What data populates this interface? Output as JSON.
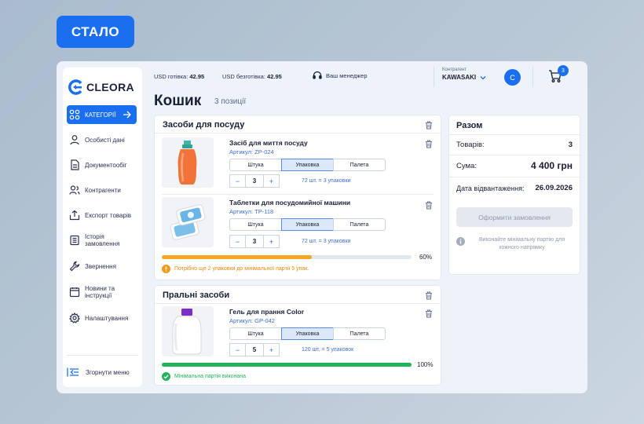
{
  "badge": "СТАЛО",
  "brand": {
    "name": "CLEORA",
    "accent": "#1a6ff0"
  },
  "sidebar": {
    "items": [
      {
        "label": "КАТЕГОРІЇ",
        "icon": "grid-icon",
        "active": true
      },
      {
        "label": "Особисті дані",
        "icon": "user-icon"
      },
      {
        "label": "Документообіг",
        "icon": "document-icon"
      },
      {
        "label": "Контрагенти",
        "icon": "users-icon"
      },
      {
        "label": "Експорт товарів",
        "icon": "upload-icon"
      },
      {
        "label": "Історія замовлення",
        "icon": "list-icon"
      },
      {
        "label": "Звернення",
        "icon": "wrench-icon"
      },
      {
        "label": "Новини та інструкції",
        "icon": "calendar-icon"
      },
      {
        "label": "Налаштування",
        "icon": "gear-icon"
      }
    ],
    "collapse_label": "Згорнути меню"
  },
  "topbar": {
    "usd_cash_label": "USD готівка:",
    "usd_cash_value": "42.95",
    "usd_noncash_label": "USD безготівка:",
    "usd_noncash_value": "42.95",
    "manager_label": "Ваш менеджер",
    "contractor_label": "Контрагент",
    "contractor_value": "KAWASAKI",
    "avatar_letter": "C",
    "cart_count": "3"
  },
  "page": {
    "title": "Кошик",
    "subtitle": "3 позиції"
  },
  "groups": [
    {
      "title": "Засоби для посуду",
      "items": [
        {
          "name": "Засіб для миття посуду",
          "sku": "Артикул: ZP-024",
          "units": [
            "Штука",
            "Упаковка",
            "Палета"
          ],
          "selected": 1,
          "qty": "3",
          "note": "72 шт. = 3 упаковки"
        },
        {
          "name": "Таблетки для посудомийної машини",
          "sku": "Артикул: TP-118",
          "units": [
            "Штука",
            "Упаковка",
            "Палета"
          ],
          "selected": 1,
          "qty": "3",
          "note": "72 шт. = 3 упаковки"
        }
      ],
      "progress": 0.6,
      "progress_label": "60%",
      "progress_color": "#f5a623",
      "status": "Потрібно ще 2 упаковки до мінімальної партії 5 упак.",
      "status_color": "#e8890c"
    },
    {
      "title": "Пральні засоби",
      "items": [
        {
          "name": "Гель для прання Color",
          "sku": "Артикул: GP-042",
          "units": [
            "Штука",
            "Упаковка",
            "Палета"
          ],
          "selected": 1,
          "qty": "5",
          "note": "120 шт. = 5 упаковок"
        }
      ],
      "progress": 1.0,
      "progress_label": "100%",
      "progress_color": "#22b35a",
      "status": "Мінімальна партія виконана",
      "status_color": "#22b35a"
    }
  ],
  "summary": {
    "title": "Разом",
    "items_label": "Товарів:",
    "items_value": "3",
    "sum_label": "Сума:",
    "sum_value": "4 400 грн",
    "date_label": "Дата відвантаження:",
    "date_value": "26.09.2026",
    "order_button": "Оформити замовлення",
    "info": "Виконайте мінімальну партію для кожного напрямку"
  }
}
